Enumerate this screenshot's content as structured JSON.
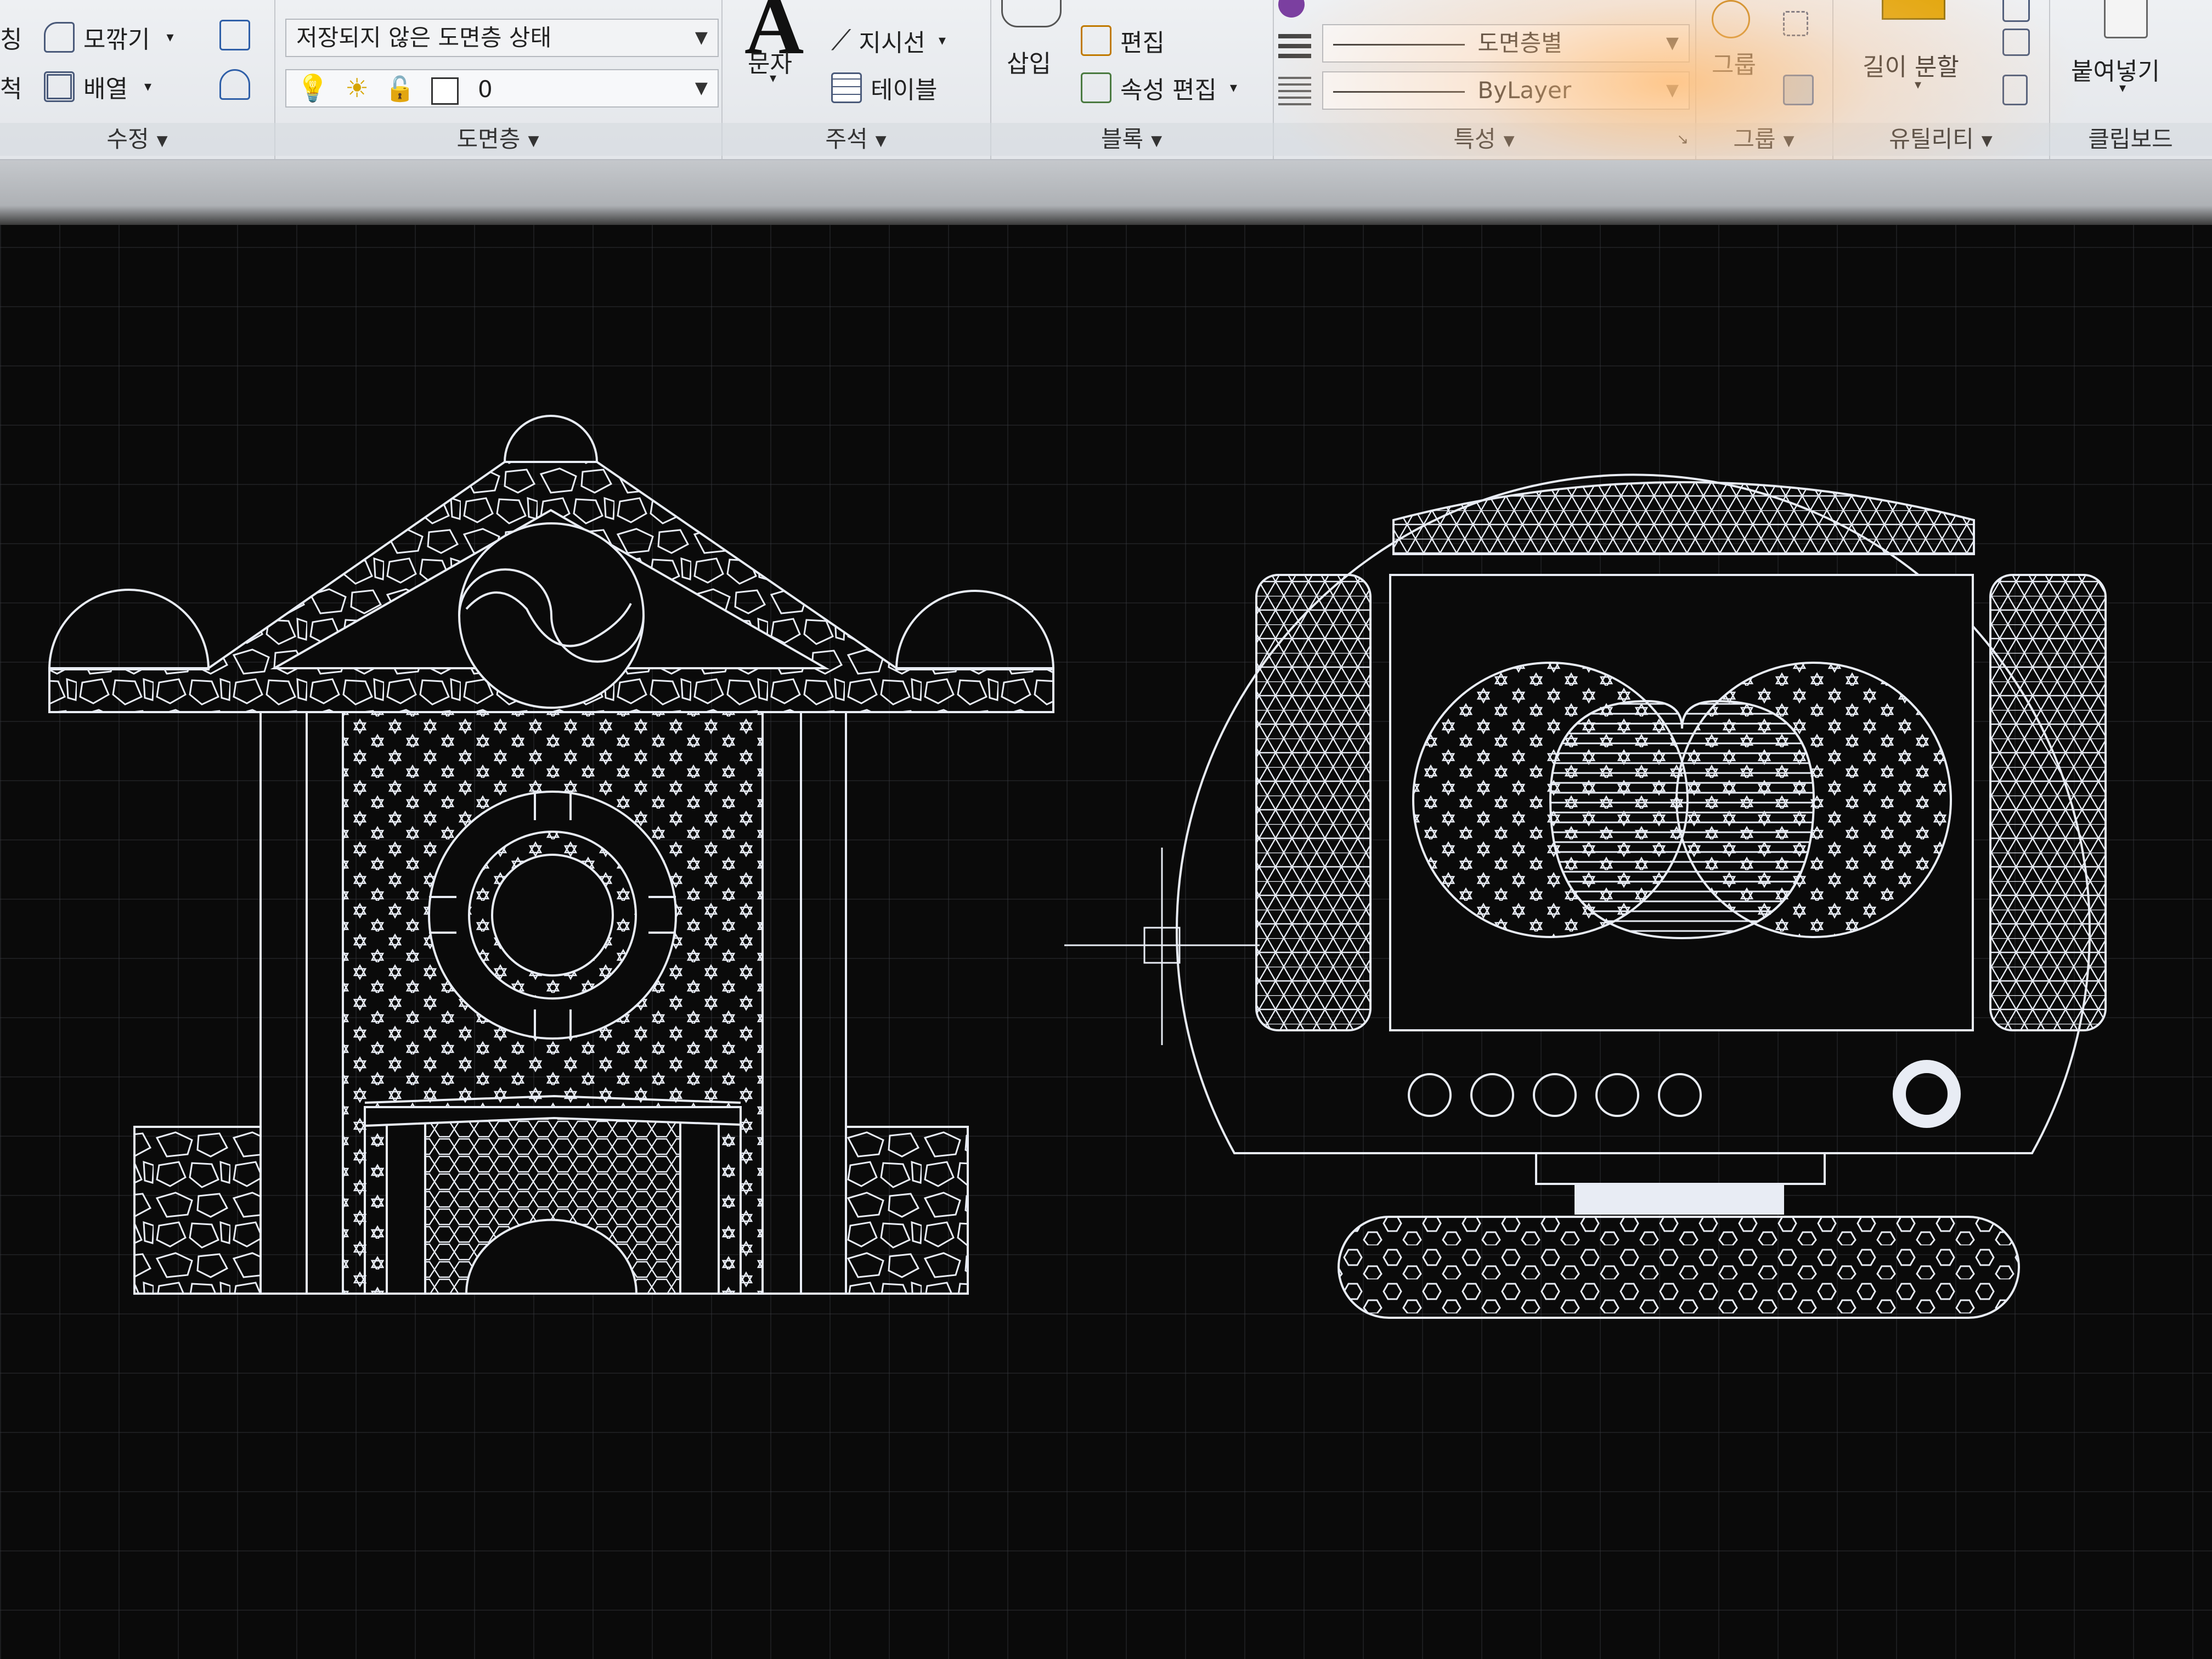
{
  "ribbon": {
    "modify": {
      "fillet": "모깎기",
      "array": "배열",
      "label": "수정",
      "cut_left_1": "칭",
      "cut_left_2": "척"
    },
    "layers": {
      "layer_state": "저장되지 않은 도면층 상태",
      "current_layer": "0",
      "label": "도면층"
    },
    "annotation": {
      "text": "문자",
      "leader": "지시선",
      "table": "테이블",
      "label": "주석"
    },
    "block": {
      "insert": "삽입",
      "edit": "편집",
      "edit_attributes": "속성 편집",
      "label": "블록"
    },
    "properties": {
      "color_value": "도면층별",
      "linetype_value": "ByLayer",
      "label": "특성"
    },
    "groups": {
      "group": "그룹",
      "label": "그룹"
    },
    "utilities": {
      "measure": "길이 분할",
      "label": "유틸리티"
    },
    "clipboard": {
      "paste": "붙여넣기",
      "label": "클립보드"
    }
  },
  "colors": {
    "ribbon_bg": "#e8eaee",
    "canvas_bg": "#0a0a0a",
    "line_color": "#e8ecf4",
    "layer_bulb": "#e8c200",
    "color_swatch": "#7b3fa0"
  },
  "icons": [
    "fillet-icon",
    "array-icon",
    "layer-properties-icon",
    "lightbulb-icon",
    "sun-icon",
    "unlock-icon",
    "leader-icon",
    "table-icon",
    "insert-block-icon",
    "edit-block-icon",
    "edit-attributes-icon",
    "group-icon",
    "measure-icon",
    "paste-icon",
    "crosshair-cursor-icon"
  ]
}
